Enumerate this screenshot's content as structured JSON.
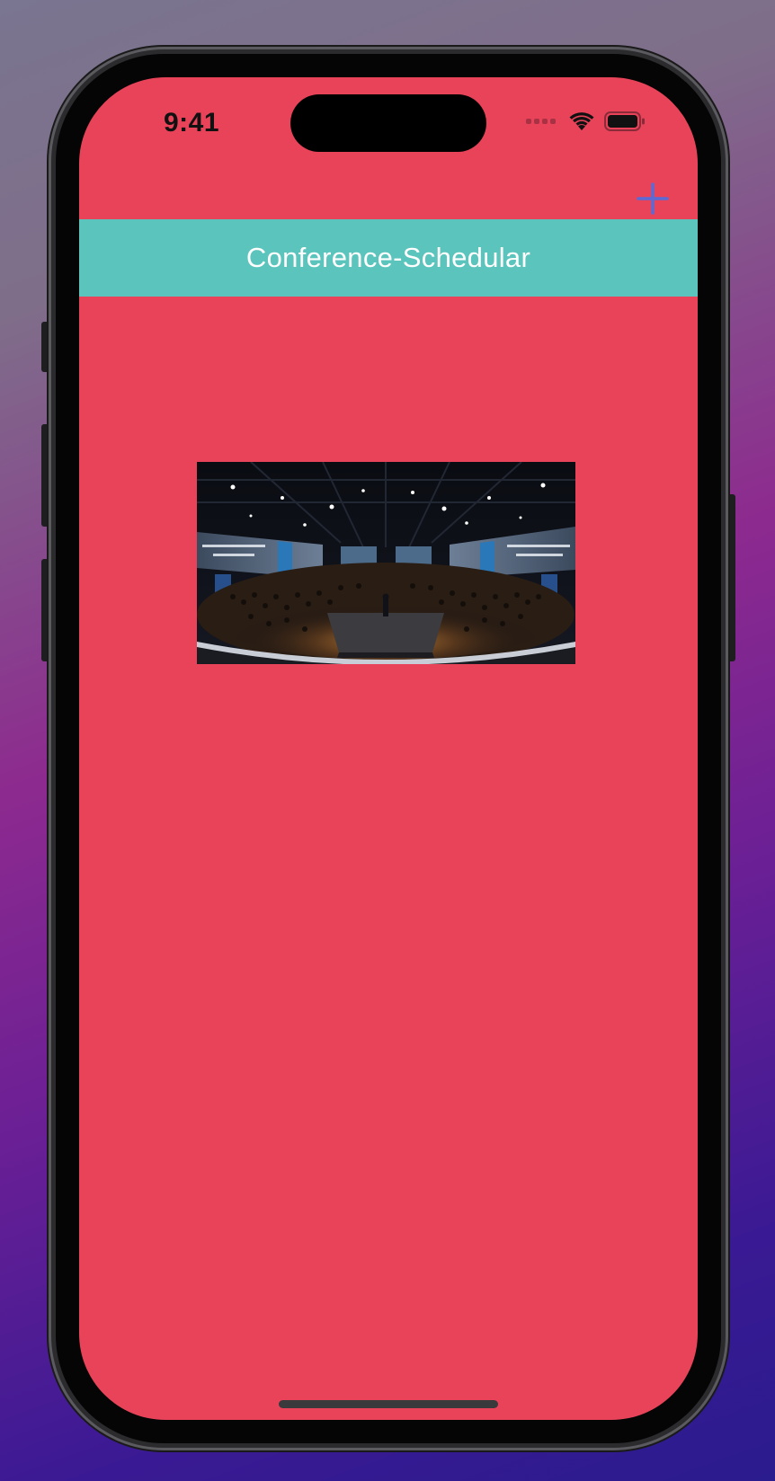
{
  "status_bar": {
    "time": "9:41",
    "icons": [
      "cellular-signal-icon",
      "wifi-icon",
      "battery-icon"
    ]
  },
  "navigation": {
    "add_icon": "plus-icon",
    "title": "Conference-Schedular"
  },
  "content": {
    "image": "conference-hall-photo"
  },
  "colors": {
    "screen_background": "#e9435a",
    "nav_bar_background": "#5bc4bc",
    "nav_title_color": "#ffffff",
    "add_button_color": "#5b6bd6",
    "status_text_color": "#111111"
  }
}
